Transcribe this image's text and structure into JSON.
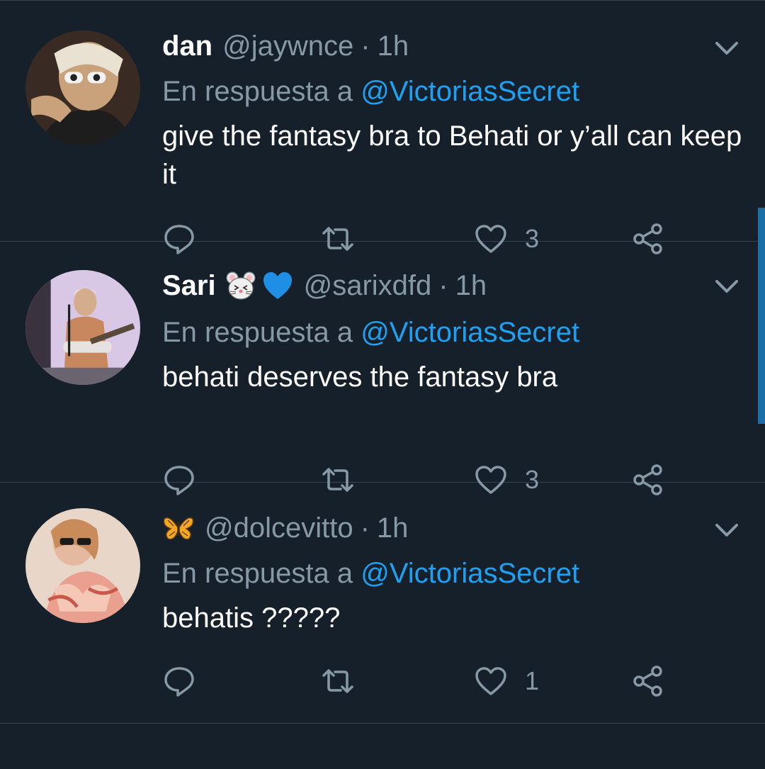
{
  "tweets": [
    {
      "name": "dan",
      "handle": "@jaywnce",
      "dot": "·",
      "time": "1h",
      "reply_prefix": "En respuesta a",
      "reply_to": "@VictoriasSecret",
      "text": "give the fantasy bra to Behati or y’all can keep it",
      "likes": "3",
      "badges": []
    },
    {
      "name": "Sari",
      "handle": "@sarixdfd",
      "dot": "·",
      "time": "1h",
      "reply_prefix": "En respuesta a",
      "reply_to": "@VictoriasSecret",
      "text": "behati deserves the fantasy bra",
      "likes": "3",
      "badges": [
        "mouse-face-emoji",
        "blue-heart-emoji"
      ]
    },
    {
      "name": "",
      "handle": "@dolcevitto",
      "dot": "·",
      "time": "1h",
      "reply_prefix": "En respuesta a",
      "reply_to": "@VictoriasSecret",
      "text": "behatis ?????",
      "likes": "1",
      "badges": [
        "butterfly-emoji"
      ]
    }
  ],
  "icons": {
    "reply": "reply-icon",
    "retweet": "retweet-icon",
    "like": "heart-icon",
    "share": "share-icon",
    "menu": "chevron-down-icon"
  },
  "colors": {
    "background": "#15202b",
    "divider": "#38444d",
    "secondary_text": "#8899a6",
    "mention": "#1da1f2"
  }
}
